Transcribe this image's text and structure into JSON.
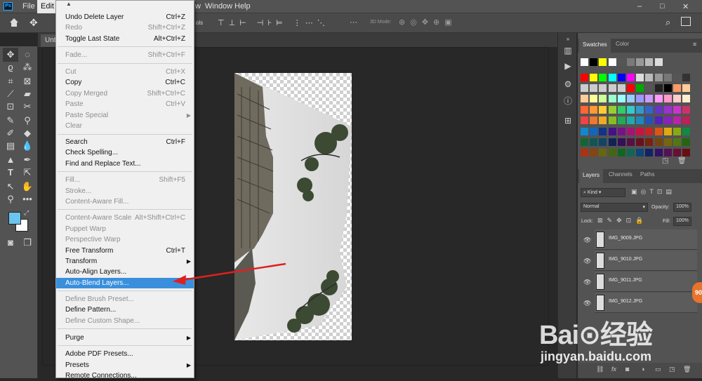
{
  "app": {
    "logo": "Ps"
  },
  "menubar": {
    "file": "File",
    "edit": "Edit",
    "view_fragment": "w",
    "window": "Window",
    "help": "Help"
  },
  "window_controls": {
    "minimize": "–",
    "maximize": "□",
    "close": "✕"
  },
  "options_bar": {
    "fragment": "ols",
    "mode_label": "3D Mode:"
  },
  "doc_tab": {
    "label": "Unti"
  },
  "status": {
    "zoom": "5%"
  },
  "edit_menu": {
    "items": [
      {
        "label": "Undo Delete Layer",
        "shortcut": "Ctrl+Z",
        "disabled": false
      },
      {
        "label": "Redo",
        "shortcut": "Shift+Ctrl+Z",
        "disabled": true
      },
      {
        "label": "Toggle Last State",
        "shortcut": "Alt+Ctrl+Z",
        "disabled": false
      },
      {
        "label": "Fade...",
        "shortcut": "Shift+Ctrl+F",
        "disabled": true
      },
      {
        "label": "Cut",
        "shortcut": "Ctrl+X",
        "disabled": true
      },
      {
        "label": "Copy",
        "shortcut": "Ctrl+C",
        "disabled": false
      },
      {
        "label": "Copy Merged",
        "shortcut": "Shift+Ctrl+C",
        "disabled": true
      },
      {
        "label": "Paste",
        "shortcut": "Ctrl+V",
        "disabled": true
      },
      {
        "label": "Paste Special",
        "shortcut": "",
        "disabled": true
      },
      {
        "label": "Clear",
        "shortcut": "",
        "disabled": true
      },
      {
        "label": "Search",
        "shortcut": "Ctrl+F",
        "disabled": false
      },
      {
        "label": "Check Spelling...",
        "shortcut": "",
        "disabled": false
      },
      {
        "label": "Find and Replace Text...",
        "shortcut": "",
        "disabled": false
      },
      {
        "label": "Fill...",
        "shortcut": "Shift+F5",
        "disabled": true
      },
      {
        "label": "Stroke...",
        "shortcut": "",
        "disabled": true
      },
      {
        "label": "Content-Aware Fill...",
        "shortcut": "",
        "disabled": true
      },
      {
        "label": "Content-Aware Scale",
        "shortcut": "Alt+Shift+Ctrl+C",
        "disabled": true
      },
      {
        "label": "Puppet Warp",
        "shortcut": "",
        "disabled": true
      },
      {
        "label": "Perspective Warp",
        "shortcut": "",
        "disabled": true
      },
      {
        "label": "Free Transform",
        "shortcut": "Ctrl+T",
        "disabled": false
      },
      {
        "label": "Transform",
        "shortcut": "",
        "disabled": false
      },
      {
        "label": "Auto-Align Layers...",
        "shortcut": "",
        "disabled": false
      },
      {
        "label": "Auto-Blend Layers...",
        "shortcut": "",
        "disabled": false,
        "highlighted": true
      },
      {
        "label": "Define Brush Preset...",
        "shortcut": "",
        "disabled": true
      },
      {
        "label": "Define Pattern...",
        "shortcut": "",
        "disabled": false
      },
      {
        "label": "Define Custom Shape...",
        "shortcut": "",
        "disabled": true
      },
      {
        "label": "Purge",
        "shortcut": "",
        "disabled": false
      },
      {
        "label": "Adobe PDF Presets...",
        "shortcut": "",
        "disabled": false
      },
      {
        "label": "Presets",
        "shortcut": "",
        "disabled": false
      },
      {
        "label": "Remote Connections...",
        "shortcut": "",
        "disabled": false
      }
    ]
  },
  "swatches_panel": {
    "tabs": [
      "Swatches",
      "Color"
    ],
    "rows": [
      [
        "#ffffff",
        "#000000",
        "#ffff00",
        "#ffffff",
        "#555555",
        "#7a7a7a",
        "#999999",
        "#bbbbbb",
        "#dddddd"
      ],
      [
        "#ff0000",
        "#ffff00",
        "#00ff00",
        "#00ffff",
        "#0000ff",
        "#ff00ff",
        "#dddddd",
        "#bbbbbb",
        "#999999",
        "#777777",
        "#555555",
        "#333333"
      ],
      [
        "#cccccc",
        "#cccccc",
        "#cccccc",
        "#cccccc",
        "#cccccc",
        "#ff0000",
        "#00aa00",
        "#555555",
        "#222222",
        "#000000",
        "#ff9966",
        "#ffcc99"
      ],
      [
        "#ffcc99",
        "#ffff99",
        "#ccff99",
        "#99ffcc",
        "#99ffff",
        "#99ccff",
        "#9999ff",
        "#cc99ff",
        "#ff99ff",
        "#ff99cc",
        "#ffcccc",
        "#ffeecc"
      ],
      [
        "#ff6633",
        "#ff9933",
        "#ffcc33",
        "#99cc33",
        "#33cc66",
        "#33cccc",
        "#3399cc",
        "#3366cc",
        "#6633cc",
        "#9933cc",
        "#cc33cc",
        "#cc3366"
      ],
      [
        "#ee4444",
        "#ee7733",
        "#eeaa22",
        "#88bb22",
        "#22aa55",
        "#22aaaa",
        "#2288bb",
        "#2255bb",
        "#5522bb",
        "#8822bb",
        "#bb22aa",
        "#bb2255"
      ],
      [
        "#1188cc",
        "#1166bb",
        "#113388",
        "#441188",
        "#771188",
        "#aa1177",
        "#cc1144",
        "#cc2222",
        "#dd5511",
        "#ddaa11",
        "#88aa11",
        "#118844"
      ],
      [
        "#116633",
        "#115555",
        "#114466",
        "#112255",
        "#331155",
        "#551144",
        "#661122",
        "#772211",
        "#774411",
        "#776611",
        "#557711",
        "#226611"
      ],
      [
        "#aa3311",
        "#884411",
        "#666611",
        "#446611",
        "#116622",
        "#116655",
        "#114477",
        "#112266",
        "#331166",
        "#551155",
        "#661133",
        "#661111"
      ]
    ]
  },
  "layers_panel": {
    "tabs": [
      "Layers",
      "Channels",
      "Paths"
    ],
    "kind": "Kind",
    "blend_mode": "Normal",
    "opacity_label": "Opacity:",
    "opacity": "100%",
    "lock_label": "Lock:",
    "fill_label": "Fill:",
    "fill": "100%",
    "layers": [
      {
        "name": "IMG_9009.JPG"
      },
      {
        "name": "IMG_9010.JPG"
      },
      {
        "name": "IMG_9011.JPG"
      },
      {
        "name": "IMG_9012.JPG"
      }
    ],
    "footer_icons": [
      "link-icon",
      "fx-icon",
      "mask-icon",
      "adjustment-icon",
      "group-icon",
      "new-layer-icon",
      "trash-icon"
    ]
  },
  "watermark": {
    "logo": "Bai⊙经验",
    "url": "jingyan.baidu.com"
  },
  "badge": {
    "text": "90"
  },
  "colors": {
    "accent": "#3a8fdc",
    "annotation_arrow": "#e02020",
    "foreground_color": "#6cc4ee"
  }
}
